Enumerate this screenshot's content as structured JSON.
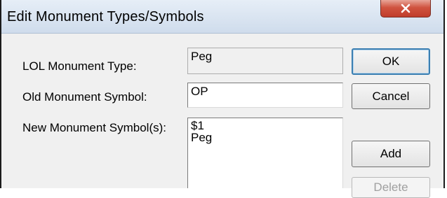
{
  "window": {
    "title": "Edit Monument Types/Symbols",
    "close_icon": "close-icon"
  },
  "form": {
    "lol_type_label": "LOL Monument Type:",
    "lol_type_value": "Peg",
    "old_symbol_label": "Old Monument Symbol:",
    "old_symbol_value": "OP",
    "new_symbols_label": "New Monument Symbol(s):",
    "new_symbols": [
      "$1",
      "Peg"
    ]
  },
  "buttons": {
    "ok": "OK",
    "cancel": "Cancel",
    "add": "Add",
    "delete": "Delete"
  },
  "colors": {
    "dialog_bg": "#f0f0f0",
    "close_button": "#c8493a",
    "default_button_border": "#3c7fb1"
  }
}
